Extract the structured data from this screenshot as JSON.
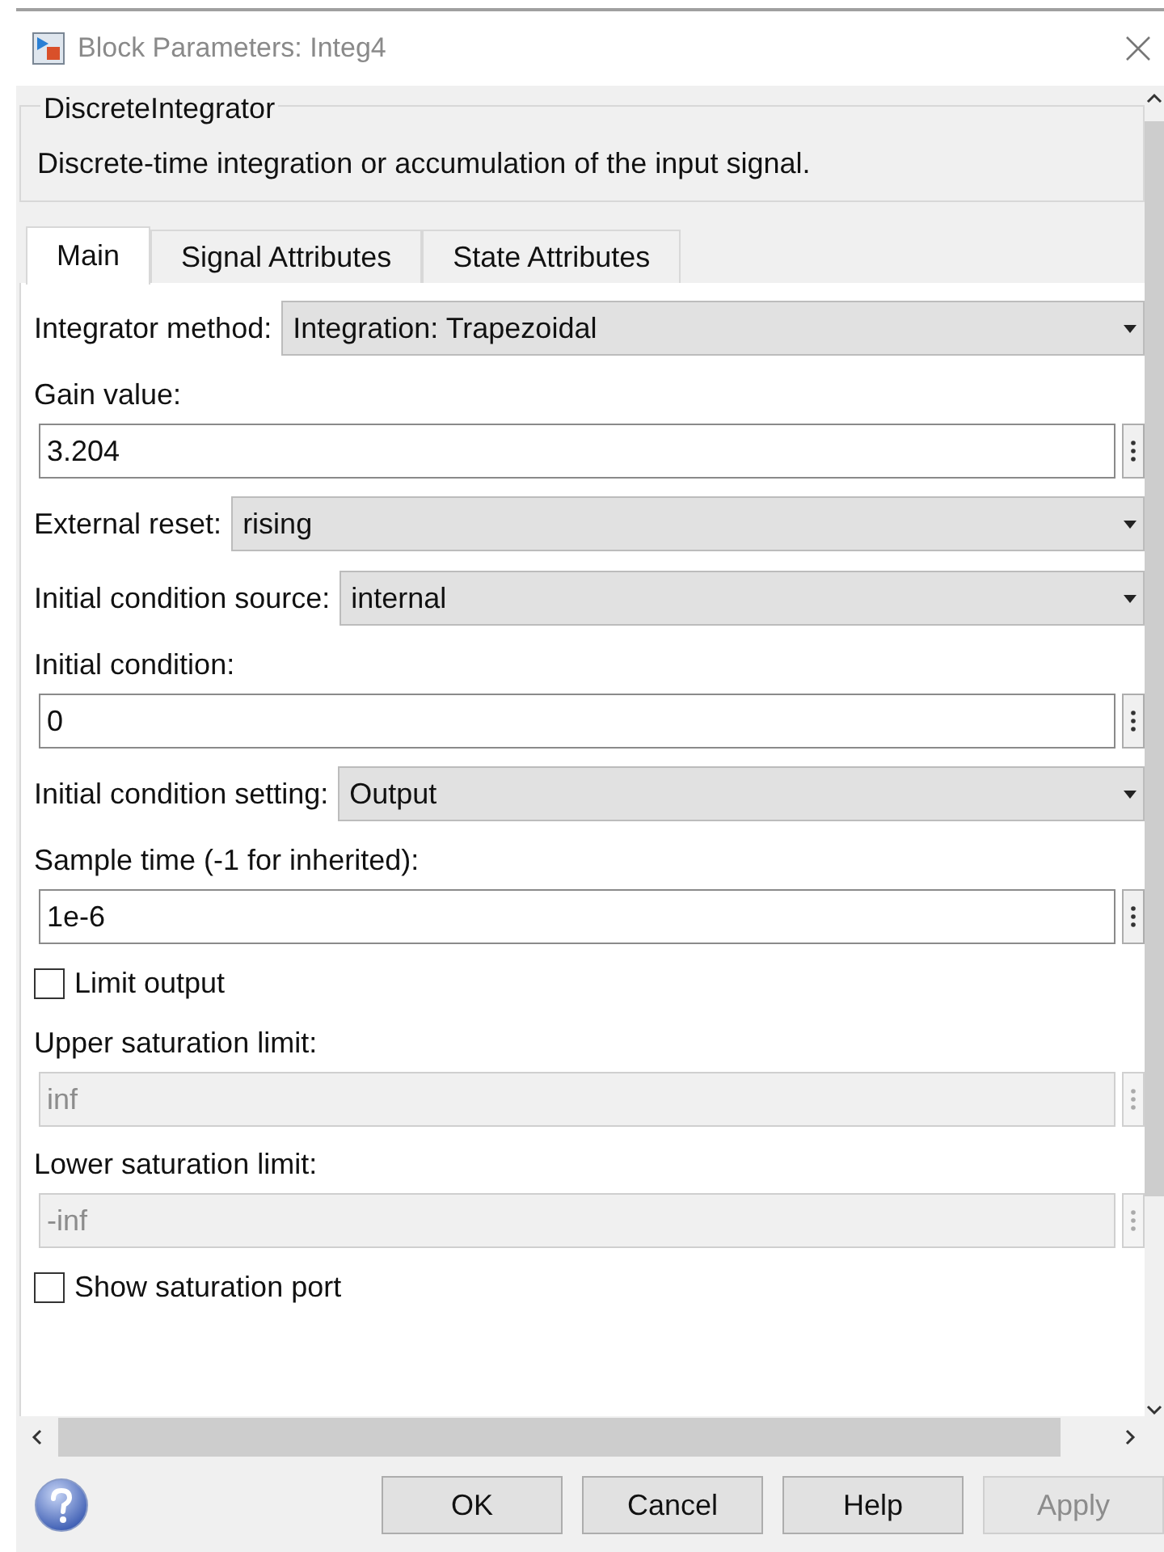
{
  "window": {
    "title": "Block Parameters: Integ4"
  },
  "group": {
    "title": "DiscreteIntegrator",
    "description": "Discrete-time integration or accumulation of the input signal."
  },
  "tabs": [
    {
      "label": "Main",
      "selected": true
    },
    {
      "label": "Signal Attributes",
      "selected": false
    },
    {
      "label": "State Attributes",
      "selected": false
    }
  ],
  "parameters": [
    {
      "kind": "popup",
      "label": "Integrator method:",
      "value": "Integration: Trapezoidal"
    },
    {
      "kind": "edit",
      "label": "Gain value:",
      "value": "3.204",
      "disabled": false
    },
    {
      "kind": "popup",
      "label": "External reset:",
      "value": "rising"
    },
    {
      "kind": "popup",
      "label": "Initial condition source:",
      "value": "internal"
    },
    {
      "kind": "edit",
      "label": "Initial condition:",
      "value": "0",
      "disabled": false
    },
    {
      "kind": "popup",
      "label": "Initial condition setting:",
      "value": "Output"
    },
    {
      "kind": "edit",
      "label": "Sample time (-1 for inherited):",
      "value": "1e-6",
      "disabled": false
    },
    {
      "kind": "checkbox",
      "label": "Limit output",
      "checked": false
    },
    {
      "kind": "edit",
      "label": "Upper saturation limit:",
      "value": "inf",
      "disabled": true
    },
    {
      "kind": "edit",
      "label": "Lower saturation limit:",
      "value": "-inf",
      "disabled": true
    },
    {
      "kind": "checkbox",
      "label": "Show saturation port",
      "checked": false
    }
  ],
  "buttons": [
    {
      "label": "OK",
      "disabled": false
    },
    {
      "label": "Cancel",
      "disabled": false
    },
    {
      "label": "Help",
      "disabled": false
    },
    {
      "label": "Apply",
      "disabled": true
    }
  ]
}
